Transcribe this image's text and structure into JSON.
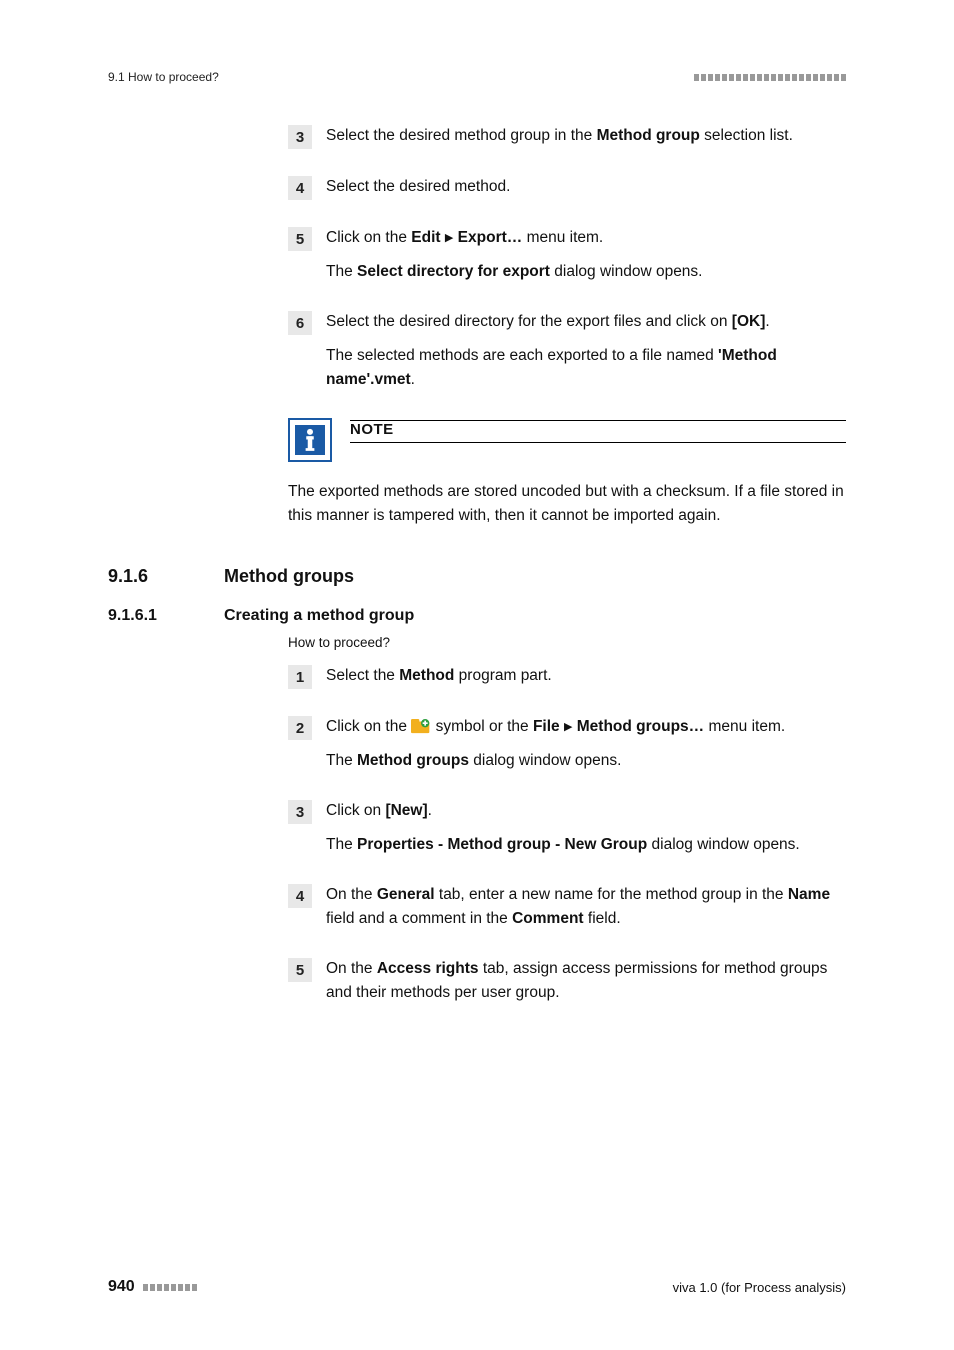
{
  "header": {
    "section": "9.1 How to proceed?"
  },
  "steps_a": [
    {
      "n": "3",
      "paras": [
        [
          {
            "t": "Select the desired method group in the "
          },
          {
            "t": "Method group",
            "b": true
          },
          {
            "t": " selection list."
          }
        ]
      ]
    },
    {
      "n": "4",
      "paras": [
        [
          {
            "t": "Select the desired method."
          }
        ]
      ]
    },
    {
      "n": "5",
      "paras": [
        [
          {
            "t": "Click on the "
          },
          {
            "t": "Edit",
            "b": true
          },
          {
            "t": " "
          },
          {
            "tri": true
          },
          {
            "t": " "
          },
          {
            "t": "Export…",
            "b": true
          },
          {
            "t": " menu item."
          }
        ],
        [
          {
            "t": "The "
          },
          {
            "t": "Select directory for export",
            "b": true
          },
          {
            "t": " dialog window opens."
          }
        ]
      ]
    },
    {
      "n": "6",
      "paras": [
        [
          {
            "t": "Select the desired directory for the export files and click on "
          },
          {
            "t": "[OK]",
            "b": true
          },
          {
            "t": "."
          }
        ],
        [
          {
            "t": "The selected methods are each exported to a file named "
          },
          {
            "t": "'Method name'.vmet",
            "b": true
          },
          {
            "t": "."
          }
        ]
      ]
    }
  ],
  "note": {
    "title": "NOTE",
    "text": "The exported methods are stored uncoded but with a checksum. If a file stored in this manner is tampered with, then it cannot be imported again."
  },
  "h2": {
    "num": "9.1.6",
    "title": "Method groups"
  },
  "h3": {
    "num": "9.1.6.1",
    "title": "Creating a method group"
  },
  "subline": "How to proceed?",
  "steps_b": [
    {
      "n": "1",
      "paras": [
        [
          {
            "t": "Select the "
          },
          {
            "t": "Method",
            "b": true
          },
          {
            "t": " program part."
          }
        ]
      ]
    },
    {
      "n": "2",
      "paras": [
        [
          {
            "t": "Click on the "
          },
          {
            "icon": "folder-icon"
          },
          {
            "t": " symbol or the "
          },
          {
            "t": "File",
            "b": true
          },
          {
            "t": " "
          },
          {
            "tri": true
          },
          {
            "t": " "
          },
          {
            "t": "Method groups…",
            "b": true
          },
          {
            "t": " menu item."
          }
        ],
        [
          {
            "t": "The "
          },
          {
            "t": "Method groups",
            "b": true
          },
          {
            "t": " dialog window opens."
          }
        ]
      ]
    },
    {
      "n": "3",
      "paras": [
        [
          {
            "t": "Click on "
          },
          {
            "t": "[New]",
            "b": true
          },
          {
            "t": "."
          }
        ],
        [
          {
            "t": "The "
          },
          {
            "t": "Properties - Method group - New Group",
            "b": true
          },
          {
            "t": " dialog window opens."
          }
        ]
      ]
    },
    {
      "n": "4",
      "paras": [
        [
          {
            "t": "On the "
          },
          {
            "t": "General",
            "b": true
          },
          {
            "t": " tab, enter a new name for the method group in the "
          },
          {
            "t": "Name",
            "b": true
          },
          {
            "t": " field and a comment in the "
          },
          {
            "t": "Comment",
            "b": true
          },
          {
            "t": " field."
          }
        ]
      ]
    },
    {
      "n": "5",
      "paras": [
        [
          {
            "t": "On the "
          },
          {
            "t": "Access rights",
            "b": true
          },
          {
            "t": " tab, assign access permissions for method groups and their methods per user group."
          }
        ]
      ]
    }
  ],
  "footer": {
    "page": "940",
    "doc": "viva 1.0 (for Process analysis)"
  }
}
